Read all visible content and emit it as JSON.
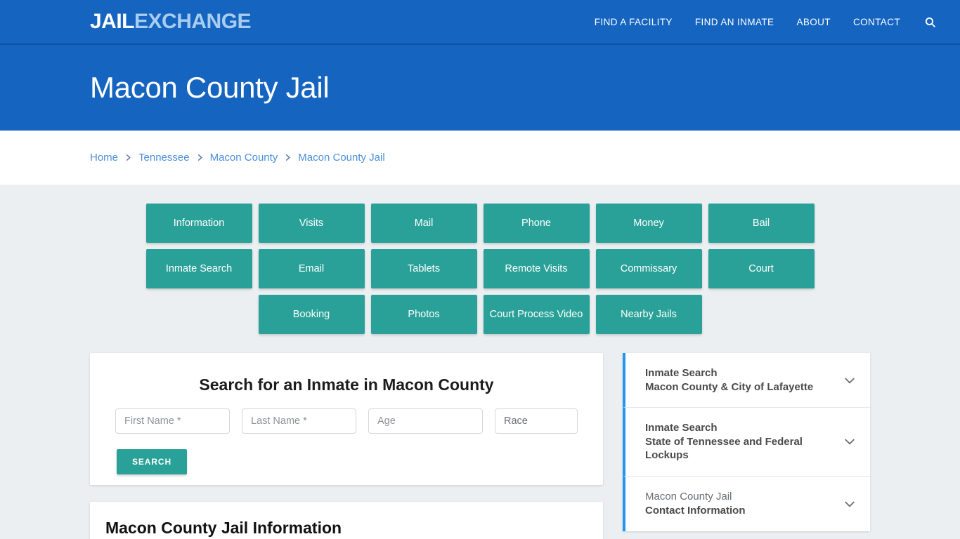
{
  "header": {
    "logo_primary": "JAIL",
    "logo_secondary": "EXCHANGE",
    "nav": [
      {
        "label": "FIND A FACILITY"
      },
      {
        "label": "FIND AN INMATE"
      },
      {
        "label": "ABOUT"
      },
      {
        "label": "CONTACT"
      }
    ],
    "search_icon": "search-icon",
    "accent_blue": "#1565c0"
  },
  "banner": {
    "title": "Macon County Jail"
  },
  "breadcrumb": {
    "items": [
      {
        "label": "Home"
      },
      {
        "label": "Tennessee"
      },
      {
        "label": "Macon County"
      },
      {
        "label": "Macon County Jail"
      }
    ],
    "separator_icon": "chevron-right-icon",
    "link_color": "#4a90d9"
  },
  "nav_buttons": {
    "accent_teal": "#2aa198",
    "items": [
      {
        "label": "Information"
      },
      {
        "label": "Visits"
      },
      {
        "label": "Mail"
      },
      {
        "label": "Phone"
      },
      {
        "label": "Money"
      },
      {
        "label": "Bail"
      },
      {
        "label": "Inmate Search"
      },
      {
        "label": "Email"
      },
      {
        "label": "Tablets"
      },
      {
        "label": "Remote Visits"
      },
      {
        "label": "Commissary"
      },
      {
        "label": "Court"
      },
      {
        "label": "Booking"
      },
      {
        "label": "Photos"
      },
      {
        "label": "Court Process Video"
      },
      {
        "label": "Nearby Jails"
      }
    ]
  },
  "search_form": {
    "title": "Search for an Inmate in Macon County",
    "first_name_placeholder": "First Name *",
    "first_name_value": "",
    "last_name_placeholder": "Last Name *",
    "last_name_value": "",
    "age_placeholder": "Age",
    "age_value": "",
    "race_selected": "Race",
    "race_options": [
      "Race"
    ],
    "submit_label": "SEARCH"
  },
  "info_section": {
    "title": "Macon County Jail Information"
  },
  "sidebar": {
    "accent_blue": "#2196f3",
    "panels": [
      {
        "line1": "Inmate Search",
        "line2": "Macon County & City of Lafayette",
        "muted": false
      },
      {
        "line1": "Inmate Search",
        "line2": "State of Tennessee and Federal Lockups",
        "muted": false
      },
      {
        "line1": "Macon County Jail",
        "line2": "Contact Information",
        "muted": true
      }
    ],
    "chevron_icon": "chevron-down-icon"
  }
}
